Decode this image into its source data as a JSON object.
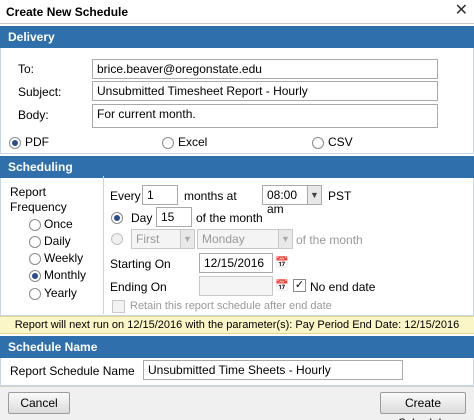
{
  "dialog": {
    "title": "Create New Schedule"
  },
  "delivery": {
    "header": "Delivery",
    "to_label": "To:",
    "to_value": "brice.beaver@oregonstate.edu",
    "subject_label": "Subject:",
    "subject_value": "Unsubmitted Timesheet Report - Hourly",
    "body_label": "Body:",
    "body_value": "For current month.",
    "formats": [
      {
        "label": "PDF",
        "selected": true
      },
      {
        "label": "Excel",
        "selected": false
      },
      {
        "label": "CSV",
        "selected": false
      }
    ]
  },
  "scheduling": {
    "header": "Scheduling",
    "frequency_label_1": "Report",
    "frequency_label_2": "Frequency",
    "frequencies": [
      {
        "label": "Once",
        "selected": false
      },
      {
        "label": "Daily",
        "selected": false
      },
      {
        "label": "Weekly",
        "selected": false
      },
      {
        "label": "Monthly",
        "selected": true
      },
      {
        "label": "Yearly",
        "selected": false
      }
    ],
    "every_label": "Every",
    "every_value": "1",
    "months_at_label": "months at",
    "time_value": "08:00 am",
    "tz_label": "PST",
    "day_label": "Day",
    "day_value": "15",
    "of_month_label": "of the month",
    "ordinal_value": "First",
    "weekday_value": "Monday",
    "of_month_label_2": "of the month",
    "starting_label": "Starting On",
    "starting_value": "12/15/2016",
    "ending_label": "Ending On",
    "ending_value": "",
    "no_end_label": "No end date",
    "retain_label": "Retain this report schedule after end date"
  },
  "notice": "Report will next run on 12/15/2016 with the parameter(s): Pay Period End Date: 12/15/2016",
  "schedule_name": {
    "header": "Schedule Name",
    "label": "Report Schedule Name",
    "value": "Unsubmitted Time Sheets - Hourly"
  },
  "buttons": {
    "cancel": "Cancel",
    "create": "Create Schedule"
  }
}
